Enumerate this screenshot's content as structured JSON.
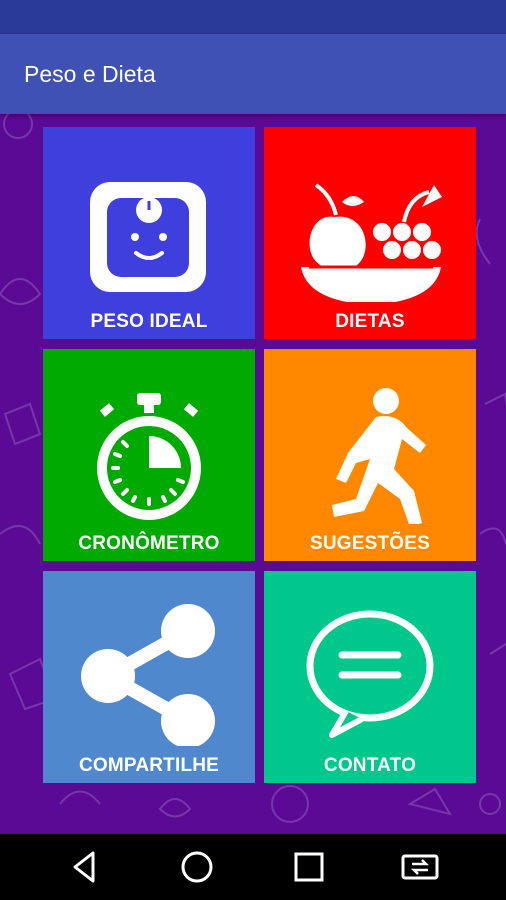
{
  "app": {
    "title": "Peso e Dieta"
  },
  "tiles": [
    {
      "label": "PESO IDEAL",
      "color": "#3f3fdd",
      "icon": "scale-icon"
    },
    {
      "label": "DIETAS",
      "color": "#ff0000",
      "icon": "fruit-bowl-icon"
    },
    {
      "label": "CRONÔMETRO",
      "color": "#00aa00",
      "icon": "stopwatch-icon"
    },
    {
      "label": "SUGESTÕES",
      "color": "#ff8800",
      "icon": "runner-icon"
    },
    {
      "label": "COMPARTILHE",
      "color": "#4f88cc",
      "icon": "share-icon"
    },
    {
      "label": "CONTATO",
      "color": "#00c78c",
      "icon": "chat-bubble-icon"
    }
  ],
  "colors": {
    "status_bar": "#2a3a99",
    "app_bar": "#3f51b5",
    "background": "#5a0a95"
  },
  "nav": {
    "icons": [
      "back-icon",
      "home-icon",
      "recents-icon",
      "rotate-icon"
    ]
  }
}
